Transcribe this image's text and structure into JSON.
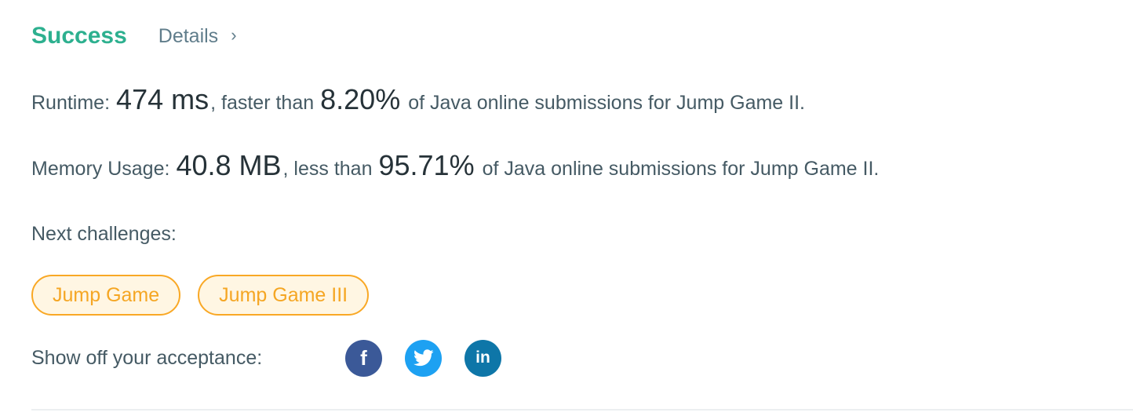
{
  "header": {
    "status": "Success",
    "details_label": "Details",
    "details_chevron": "›"
  },
  "runtime": {
    "label": "Runtime:",
    "value": "474 ms",
    "comparison": ", faster than",
    "percent": "8.20%",
    "suffix": "of Java online submissions for Jump Game II."
  },
  "memory": {
    "label": "Memory Usage:",
    "value": "40.8 MB",
    "comparison": ", less than",
    "percent": "95.71%",
    "suffix": "of Java online submissions for Jump Game II."
  },
  "next": {
    "label": "Next challenges:",
    "challenges": [
      "Jump Game",
      "Jump Game III"
    ]
  },
  "share": {
    "label": "Show off your acceptance:",
    "networks": [
      {
        "name": "facebook",
        "icon": "facebook-icon",
        "glyph": "f",
        "color": "#3b5998"
      },
      {
        "name": "twitter",
        "icon": "twitter-icon",
        "color": "#1da1f2"
      },
      {
        "name": "linkedin",
        "icon": "linkedin-icon",
        "glyph": "in",
        "color": "#0e76a8"
      }
    ]
  },
  "colors": {
    "success": "#2db08f",
    "challenge_border": "#f9a825",
    "challenge_text": "#f5a623",
    "text": "#455a64"
  }
}
